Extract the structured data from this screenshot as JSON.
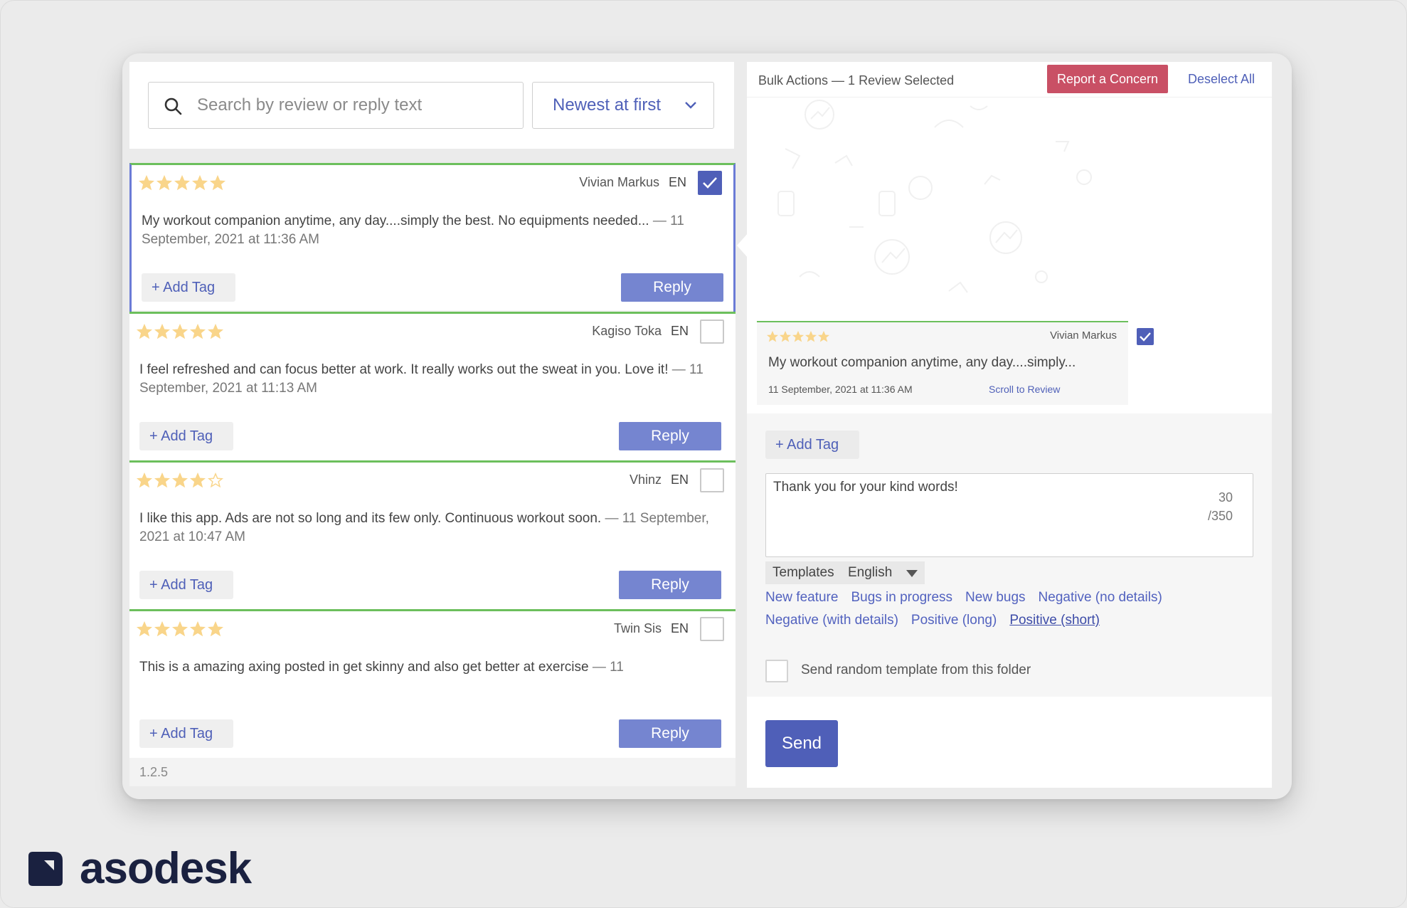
{
  "search": {
    "placeholder": "Search by review or reply text"
  },
  "sort": {
    "selected": "Newest at first"
  },
  "reviews": [
    {
      "rating": 5,
      "author": "Vivian Markus",
      "lang": "EN",
      "checked": true,
      "text": "My workout companion anytime, any day....simply the best. No equipments needed...",
      "date": "— 11 September, 2021 at 11:36 AM",
      "add_tag": "Add Tag",
      "reply": "Reply",
      "version": "1.2.5"
    },
    {
      "rating": 5,
      "author": "Kagiso Toka",
      "lang": "EN",
      "checked": false,
      "text": "I feel refreshed and can focus better at work. It really works out the sweat in you. Love it!",
      "date": "— 11 September, 2021 at 11:13 AM",
      "add_tag": "Add Tag",
      "reply": "Reply",
      "version": "1.2.5"
    },
    {
      "rating": 4,
      "author": "Vhinz",
      "lang": "EN",
      "checked": false,
      "text": "I like this app. Ads are not so long and its few only. Continuous workout soon.",
      "date": "— 11 September, 2021 at 10:47 AM",
      "add_tag": "Add Tag",
      "reply": "Reply",
      "version": "1.2.5"
    },
    {
      "rating": 5,
      "author": "Twin Sis",
      "lang": "EN",
      "checked": false,
      "text": "This is a amazing axing posted in get skinny and also get better at exercise",
      "date": "— 11",
      "add_tag": "Add Tag",
      "reply": "Reply",
      "version": "1.2.5"
    }
  ],
  "bulk": {
    "title": "Bulk Actions — 1 Review Selected",
    "report_label": "Report a Concern",
    "deselect_label": "Deselect All",
    "selected_review": {
      "rating": 5,
      "author": "Vivian Markus",
      "text": "My workout companion anytime, any day....simply...",
      "date": "11 September, 2021 at 11:36 AM",
      "scroll_link": "Scroll to Review"
    },
    "add_tag": "Add Tag",
    "reply_text": "Thank you for your kind words!",
    "counter_current": "30",
    "counter_max": "/350",
    "templates_label": "Templates",
    "templates_lang": "English",
    "template_rows": [
      [
        "New feature",
        "Bugs in progress",
        "New bugs",
        "Negative (no details)"
      ],
      [
        "Negative (with details)",
        "Positive (long)",
        "Positive (short)"
      ]
    ],
    "active_template": "Positive (short)",
    "random_label": "Send random template from this folder",
    "send_label": "Send"
  },
  "brand": {
    "name": "asodesk"
  },
  "colors": {
    "accent": "#4f5fb8",
    "reply_button": "#7585d0",
    "report": "#c95065",
    "review_border": "#6cbf5c",
    "star": "#f9d58a"
  }
}
